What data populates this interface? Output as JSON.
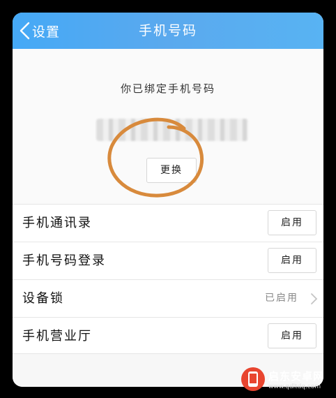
{
  "navbar": {
    "back_label": "设置",
    "title": "手机号码",
    "color": "#4faaf3"
  },
  "bound": {
    "label": "你已绑定手机号码",
    "change_label": "更换"
  },
  "annotation": {
    "color": "#d88a3c"
  },
  "list": {
    "rows": [
      {
        "label": "手机通讯录",
        "action": "启用"
      },
      {
        "label": "手机号码登录",
        "action": "启用"
      },
      {
        "label": "设备锁",
        "status": "已启用"
      },
      {
        "label": "手机营业厅",
        "action": "启用"
      }
    ]
  },
  "watermark": {
    "name": "启东安卓网",
    "url": "www.qdltdq.com",
    "icon": "phone-logo-icon"
  }
}
